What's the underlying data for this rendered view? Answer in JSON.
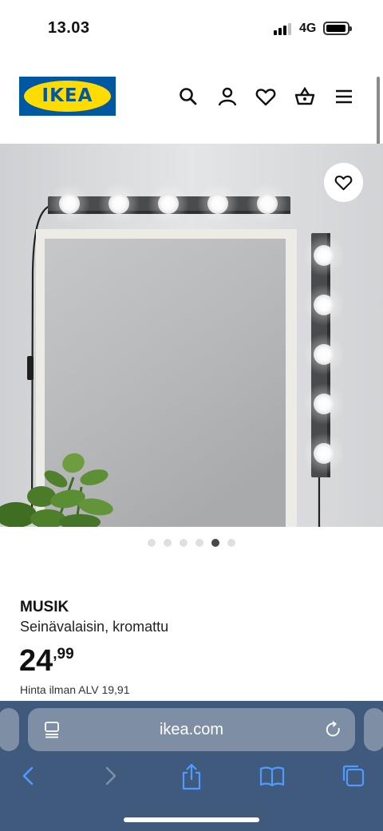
{
  "status": {
    "time": "13.03",
    "network": "4G"
  },
  "header": {
    "logo_text": "IKEA",
    "icons": [
      "search-icon",
      "account-icon",
      "heart-icon",
      "basket-icon",
      "menu-icon"
    ]
  },
  "gallery": {
    "slide_count": 6,
    "active_slide": 5
  },
  "product": {
    "name": "MUSIK",
    "description": "Seinävalaisin, kromattu",
    "price_integer": "24",
    "price_decimal": ",99",
    "vat_note": "Hinta ilman ALV 19,91"
  },
  "browser": {
    "url": "ikea.com",
    "toolbar": [
      "back-icon",
      "forward-icon",
      "share-icon",
      "bookmarks-icon",
      "tabs-icon"
    ]
  },
  "colors": {
    "ikea_blue": "#0058a3",
    "ikea_yellow": "#ffdb00",
    "safari_bar": "#3f5a7c"
  }
}
